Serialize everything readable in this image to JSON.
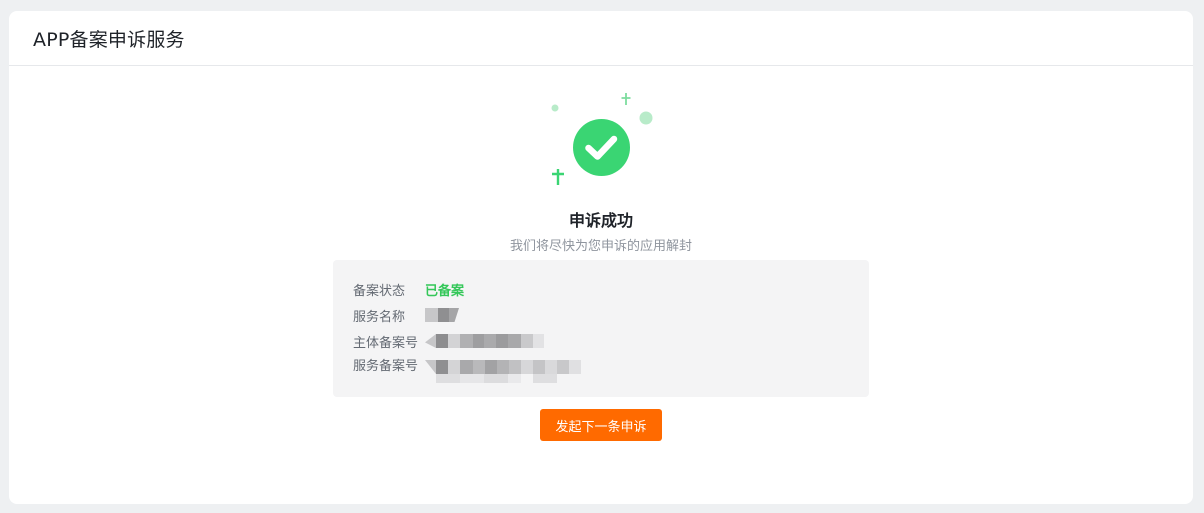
{
  "page": {
    "title": "APP备案申诉服务"
  },
  "result": {
    "icon": "success-check-icon",
    "accent_color": "#3ad573",
    "title": "申诉成功",
    "subtitle": "我们将尽快为您申诉的应用解封"
  },
  "info": {
    "status_label": "备案状态",
    "status_value": "已备案",
    "status_color": "#34c759",
    "service_name_label": "服务名称",
    "subject_filing_label": "主体备案号",
    "service_filing_label": "服务备案号"
  },
  "actions": {
    "submit_another_label": "发起下一条申诉",
    "button_color": "#ff6a00"
  }
}
